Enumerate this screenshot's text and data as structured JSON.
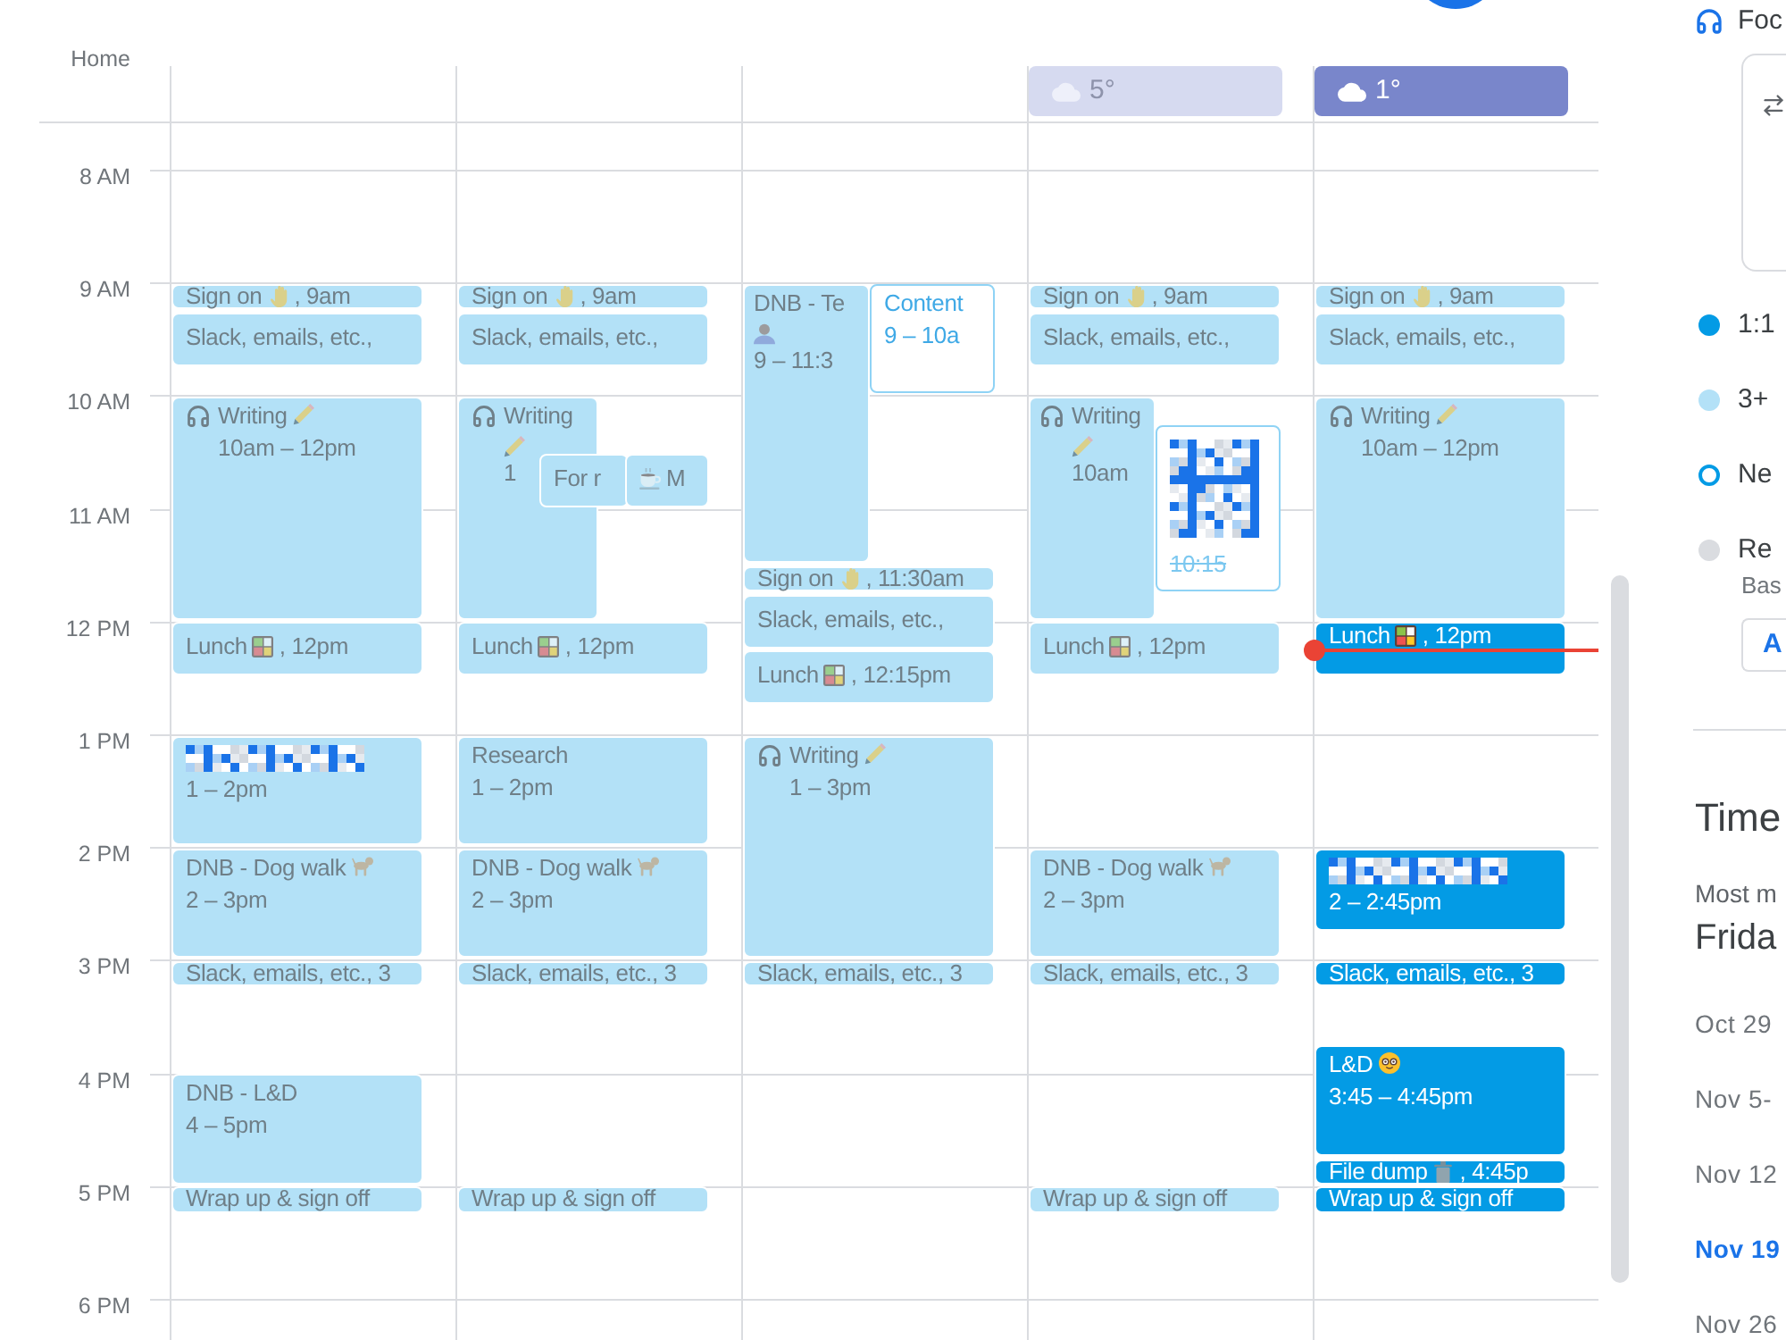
{
  "timezone_label": "Home",
  "hours": [
    "8 AM",
    "9 AM",
    "10 AM",
    "11 AM",
    "12 PM",
    "1 PM",
    "2 PM",
    "3 PM",
    "4 PM",
    "5 PM",
    "6 PM"
  ],
  "days": [
    {
      "today": false,
      "events": [
        {
          "kind": "past",
          "title": [
            {
              "kind": "text",
              "text": "Sign on"
            },
            {
              "kind": "wave"
            },
            {
              "kind": "text",
              "text": ", 9am"
            }
          ]
        },
        {
          "kind": "past",
          "title": [
            {
              "kind": "text",
              "text": "Slack, emails, etc.,"
            }
          ]
        },
        {
          "kind": "past",
          "title": [
            {
              "kind": "headphones"
            },
            {
              "kind": "text",
              "text": "Writing"
            },
            {
              "kind": "writing"
            }
          ],
          "time": "10am – 12pm"
        },
        {
          "kind": "past",
          "title": [
            {
              "kind": "text",
              "text": "Lunch"
            },
            {
              "kind": "bento"
            },
            {
              "kind": "text",
              "text": ", 12pm"
            }
          ]
        },
        {
          "kind": "past",
          "title": [
            {
              "kind": "redacted"
            }
          ],
          "time": "1 – 2pm"
        },
        {
          "kind": "past",
          "title": [
            {
              "kind": "text",
              "text": "DNB - Dog walk"
            },
            {
              "kind": "dog"
            }
          ],
          "time": "2 – 3pm"
        },
        {
          "kind": "past",
          "title": [
            {
              "kind": "text",
              "text": "Slack, emails, etc., 3"
            }
          ]
        },
        {
          "kind": "past",
          "title": [
            {
              "kind": "text",
              "text": "DNB - L&D"
            }
          ],
          "time": "4 – 5pm"
        },
        {
          "kind": "past",
          "title": [
            {
              "kind": "text",
              "text": "Wrap up & sign off"
            }
          ]
        }
      ]
    },
    {
      "today": false,
      "events": [
        {
          "kind": "past",
          "title": [
            {
              "kind": "text",
              "text": "Sign on"
            },
            {
              "kind": "wave"
            },
            {
              "kind": "text",
              "text": ", 9am"
            }
          ]
        },
        {
          "kind": "past",
          "title": [
            {
              "kind": "text",
              "text": "Slack, emails, etc.,"
            }
          ]
        },
        {
          "kind": "past",
          "title": [
            {
              "kind": "headphones"
            },
            {
              "kind": "text",
              "text": "Writing"
            },
            {
              "kind": "writing"
            }
          ],
          "time": "1"
        },
        {
          "kind": "past",
          "title": [
            {
              "kind": "text",
              "text": "For r"
            }
          ]
        },
        {
          "kind": "past",
          "title": [
            {
              "kind": "coffee"
            },
            {
              "kind": "text",
              "text": "M"
            }
          ]
        },
        {
          "kind": "past",
          "title": [
            {
              "kind": "text",
              "text": "Lunch"
            },
            {
              "kind": "bento"
            },
            {
              "kind": "text",
              "text": ", 12pm"
            }
          ]
        },
        {
          "kind": "past",
          "title": [
            {
              "kind": "text",
              "text": "Research"
            }
          ],
          "time": "1 – 2pm"
        },
        {
          "kind": "past",
          "title": [
            {
              "kind": "text",
              "text": "DNB - Dog walk"
            },
            {
              "kind": "dog"
            }
          ],
          "time": "2 – 3pm"
        },
        {
          "kind": "past",
          "title": [
            {
              "kind": "text",
              "text": "Slack, emails, etc., 3"
            }
          ]
        },
        {
          "kind": "past",
          "title": [
            {
              "kind": "text",
              "text": "Wrap up & sign off"
            }
          ]
        }
      ]
    },
    {
      "today": false,
      "events": [
        {
          "kind": "past",
          "title": [
            {
              "kind": "text",
              "text": "DNB - Te"
            },
            {
              "kind": "person"
            }
          ],
          "time": "9 – 11:3"
        },
        {
          "kind": "invited",
          "title": [
            {
              "kind": "text",
              "text": "Content"
            }
          ],
          "time": "9 – 10a"
        },
        {
          "kind": "past",
          "title": [
            {
              "kind": "text",
              "text": "Sign on"
            },
            {
              "kind": "wave"
            },
            {
              "kind": "text",
              "text": ", 11:30am"
            }
          ]
        },
        {
          "kind": "past",
          "title": [
            {
              "kind": "text",
              "text": "Slack, emails, etc.,"
            }
          ]
        },
        {
          "kind": "past",
          "title": [
            {
              "kind": "text",
              "text": "Lunch"
            },
            {
              "kind": "bento"
            },
            {
              "kind": "text",
              "text": ", 12:15pm"
            }
          ]
        },
        {
          "kind": "past",
          "title": [
            {
              "kind": "headphones"
            },
            {
              "kind": "text",
              "text": "Writing"
            },
            {
              "kind": "writing"
            }
          ],
          "time": "1 – 3pm"
        },
        {
          "kind": "past",
          "title": [
            {
              "kind": "text",
              "text": "Slack, emails, etc., 3"
            }
          ]
        }
      ]
    },
    {
      "today": false,
      "weather": "5°",
      "events": [
        {
          "kind": "past",
          "title": [
            {
              "kind": "text",
              "text": "Sign on"
            },
            {
              "kind": "wave"
            },
            {
              "kind": "text",
              "text": ", 9am"
            }
          ]
        },
        {
          "kind": "past",
          "title": [
            {
              "kind": "text",
              "text": "Slack, emails, etc.,"
            }
          ]
        },
        {
          "kind": "past",
          "title": [
            {
              "kind": "headphones"
            },
            {
              "kind": "text",
              "text": "Writing"
            },
            {
              "kind": "writing"
            }
          ],
          "time": "10am"
        },
        {
          "kind": "declined",
          "title": [
            {
              "kind": "redacted"
            }
          ],
          "time": "10:15"
        },
        {
          "kind": "past",
          "title": [
            {
              "kind": "text",
              "text": "Lunch"
            },
            {
              "kind": "bento"
            },
            {
              "kind": "text",
              "text": ", 12pm"
            }
          ]
        },
        {
          "kind": "past",
          "title": [
            {
              "kind": "text",
              "text": "DNB - Dog walk"
            },
            {
              "kind": "dog"
            }
          ],
          "time": "2 – 3pm"
        },
        {
          "kind": "past",
          "title": [
            {
              "kind": "text",
              "text": "Slack, emails, etc., 3"
            }
          ]
        },
        {
          "kind": "past",
          "title": [
            {
              "kind": "text",
              "text": "Wrap up & sign off"
            }
          ]
        }
      ]
    },
    {
      "today": true,
      "weather": "1°",
      "events": [
        {
          "kind": "past",
          "title": [
            {
              "kind": "text",
              "text": "Sign on"
            },
            {
              "kind": "wave"
            },
            {
              "kind": "text",
              "text": ", 9am"
            }
          ]
        },
        {
          "kind": "past",
          "title": [
            {
              "kind": "text",
              "text": "Slack, emails, etc.,"
            }
          ]
        },
        {
          "kind": "past",
          "title": [
            {
              "kind": "headphones"
            },
            {
              "kind": "text",
              "text": "Writing"
            },
            {
              "kind": "writing"
            }
          ],
          "time": "10am – 12pm"
        },
        {
          "kind": "upcoming",
          "title": [
            {
              "kind": "text",
              "text": "Lunch"
            },
            {
              "kind": "bento"
            },
            {
              "kind": "text",
              "text": ", 12pm"
            }
          ]
        },
        {
          "kind": "upcoming",
          "title": [
            {
              "kind": "redacted"
            }
          ],
          "time": "2 – 2:45pm"
        },
        {
          "kind": "upcoming",
          "title": [
            {
              "kind": "text",
              "text": "Slack, emails, etc., 3"
            }
          ]
        },
        {
          "kind": "upcoming",
          "title": [
            {
              "kind": "text",
              "text": "L&D"
            },
            {
              "kind": "nerd"
            }
          ],
          "time": "3:45 – 4:45pm"
        },
        {
          "kind": "upcoming",
          "title": [
            {
              "kind": "text",
              "text": "File dump"
            },
            {
              "kind": "trash"
            },
            {
              "kind": "text",
              "text": ", 4:45p"
            }
          ]
        },
        {
          "kind": "upcoming",
          "title": [
            {
              "kind": "text",
              "text": "Wrap up & sign off"
            }
          ]
        }
      ]
    }
  ],
  "side_panel": {
    "focus_label": "Foc",
    "legend": [
      {
        "kind": "filled",
        "color": "#039be5",
        "label": "1:1"
      },
      {
        "kind": "filled",
        "color": "#b3e1f7",
        "label": "3+"
      },
      {
        "kind": "ring",
        "color": "#039be5",
        "label": "Ne"
      },
      {
        "kind": "filled",
        "color": "#dadce0",
        "label": "Re",
        "note": "Bas",
        "button": "A"
      }
    ],
    "title": "Time",
    "subtitle": "Most m",
    "highlight": "Frida",
    "weeks": [
      {
        "label": "Oct 29",
        "selected": false
      },
      {
        "label": "Nov 5-",
        "selected": false
      },
      {
        "label": "Nov 12",
        "selected": false
      },
      {
        "label": "Nov 19",
        "selected": true
      },
      {
        "label": "Nov 26",
        "selected": false
      }
    ]
  }
}
